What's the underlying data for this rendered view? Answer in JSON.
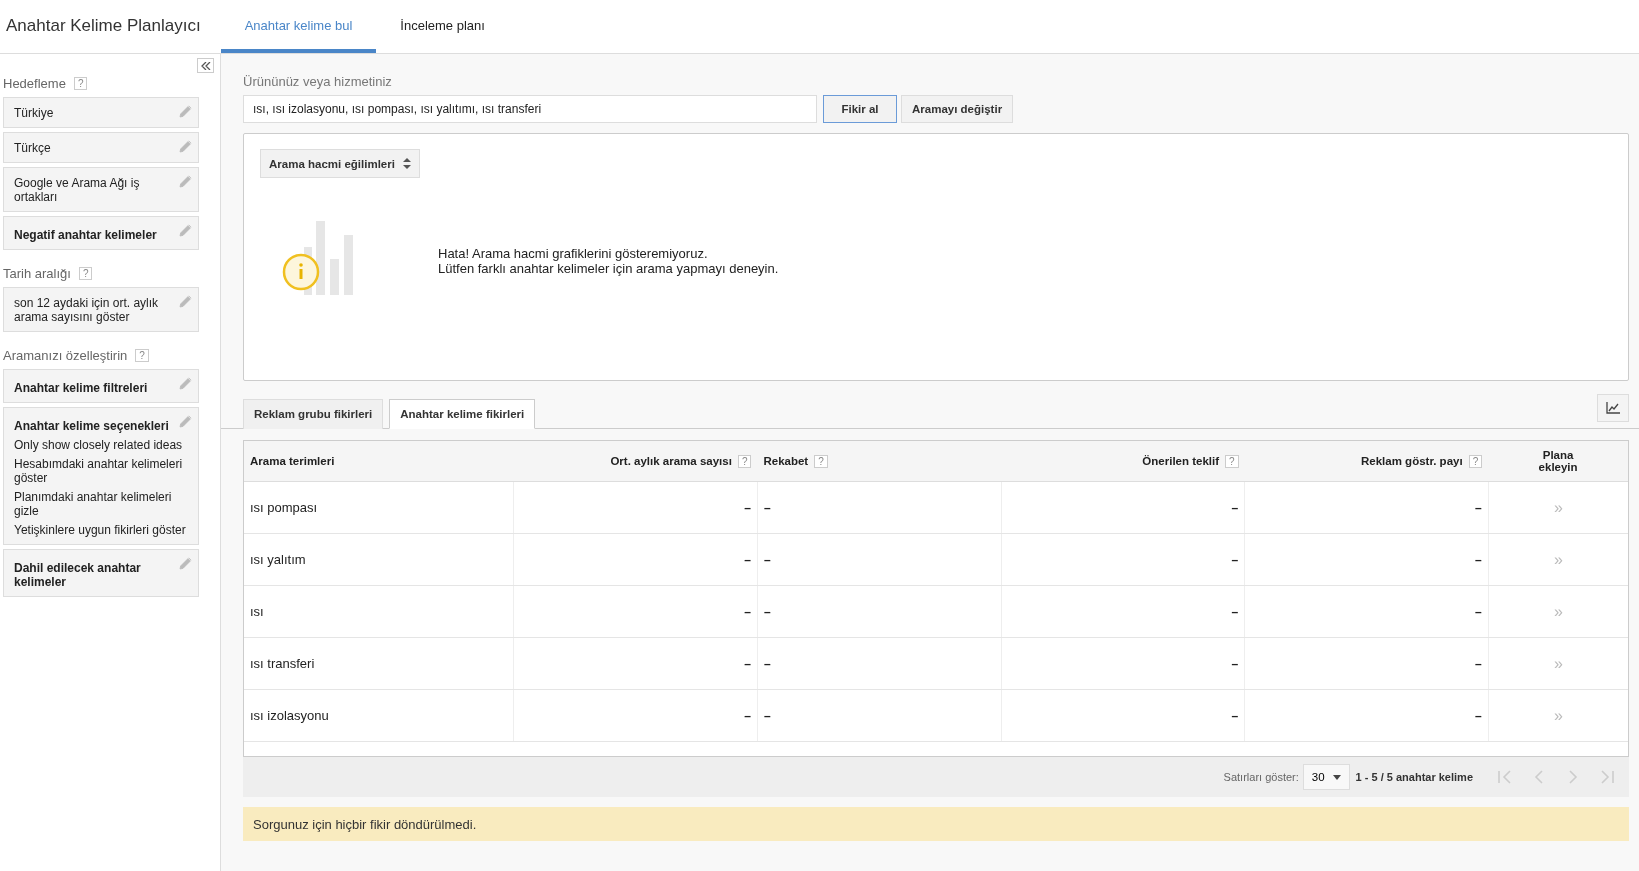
{
  "header": {
    "title": "Anahtar Kelime Planlayıcı",
    "tabs": [
      {
        "label": "Anahtar kelime bul",
        "selected": true
      },
      {
        "label": "İnceleme planı",
        "selected": false
      }
    ]
  },
  "sidebar": {
    "sections": [
      {
        "title": "Hedefleme",
        "help": "?",
        "cards": [
          {
            "kind": "plain",
            "text": "Türkiye"
          },
          {
            "kind": "plain",
            "text": "Türkçe"
          },
          {
            "kind": "plain",
            "text": "Google ve Arama Ağı iş ortakları"
          },
          {
            "kind": "bold",
            "text": "Negatif anahtar kelimeler"
          }
        ]
      },
      {
        "title": "Tarih aralığı",
        "help": "?",
        "cards": [
          {
            "kind": "plain",
            "text": "son 12 aydaki için ort. aylık arama sayısını göster"
          }
        ]
      },
      {
        "title": "Aramanızı özelleştirin",
        "help": "?",
        "cards": [
          {
            "kind": "bold",
            "text": "Anahtar kelime filtreleri"
          },
          {
            "kind": "bold",
            "text": "Anahtar kelime seçenekleri",
            "items": [
              "Only show closely related ideas",
              "Hesabımdaki anahtar kelimeleri göster",
              "Planımdaki anahtar kelimeleri gizle",
              "Yetişkinlere uygun fikirleri göster"
            ]
          },
          {
            "kind": "bold",
            "text": "Dahil edilecek anahtar kelimeler"
          }
        ]
      }
    ]
  },
  "search": {
    "label": "Ürününüz veya hizmetiniz",
    "value": "ısı, ısı izolasyonu, ısı pompası, ısı yalıtımı, ısı transferi",
    "buttons": [
      {
        "label": "Fikir al",
        "kind": "primary"
      },
      {
        "label": "Aramayı değiştir",
        "kind": "secondary"
      }
    ]
  },
  "trend": {
    "dropdown": "Arama hacmi eğilimleri",
    "messages": [
      "Hata! Arama hacmi grafiklerini gösteremiyoruz.",
      "Lütfen farklı anahtar kelimeler için arama yapmayı deneyin."
    ]
  },
  "idea_tabs": [
    {
      "label": "Reklam grubu fikirleri",
      "selected": false
    },
    {
      "label": "Anahtar kelime fikirleri",
      "selected": true
    }
  ],
  "table": {
    "columns": [
      {
        "label": "Arama terimleri"
      },
      {
        "label": "Ort. aylık arama sayısı",
        "help": "?"
      },
      {
        "label": "Rekabet",
        "help": "?"
      },
      {
        "label": "Önerilen teklif",
        "help": "?"
      },
      {
        "label": "Reklam göstr. payı",
        "help": "?"
      },
      {
        "label": "Plana ekleyin"
      }
    ],
    "rows": [
      {
        "cells": [
          "ısı pompası",
          "–",
          "–",
          "–",
          "–",
          "»"
        ]
      },
      {
        "cells": [
          "ısı yalıtım",
          "–",
          "–",
          "–",
          "–",
          "»"
        ]
      },
      {
        "cells": [
          "ısı",
          "–",
          "–",
          "–",
          "–",
          "»"
        ]
      },
      {
        "cells": [
          "ısı transferi",
          "–",
          "–",
          "–",
          "–",
          "»"
        ]
      },
      {
        "cells": [
          "ısı izolasyonu",
          "–",
          "–",
          "–",
          "–",
          "»"
        ]
      }
    ]
  },
  "pager": {
    "rows_label": "Satırları göster:",
    "rows_value": "30",
    "range": "1 - 5 / 5 anahtar kelime"
  },
  "notice": "Sorgunuz için hiçbir fikir döndürülmedi."
}
